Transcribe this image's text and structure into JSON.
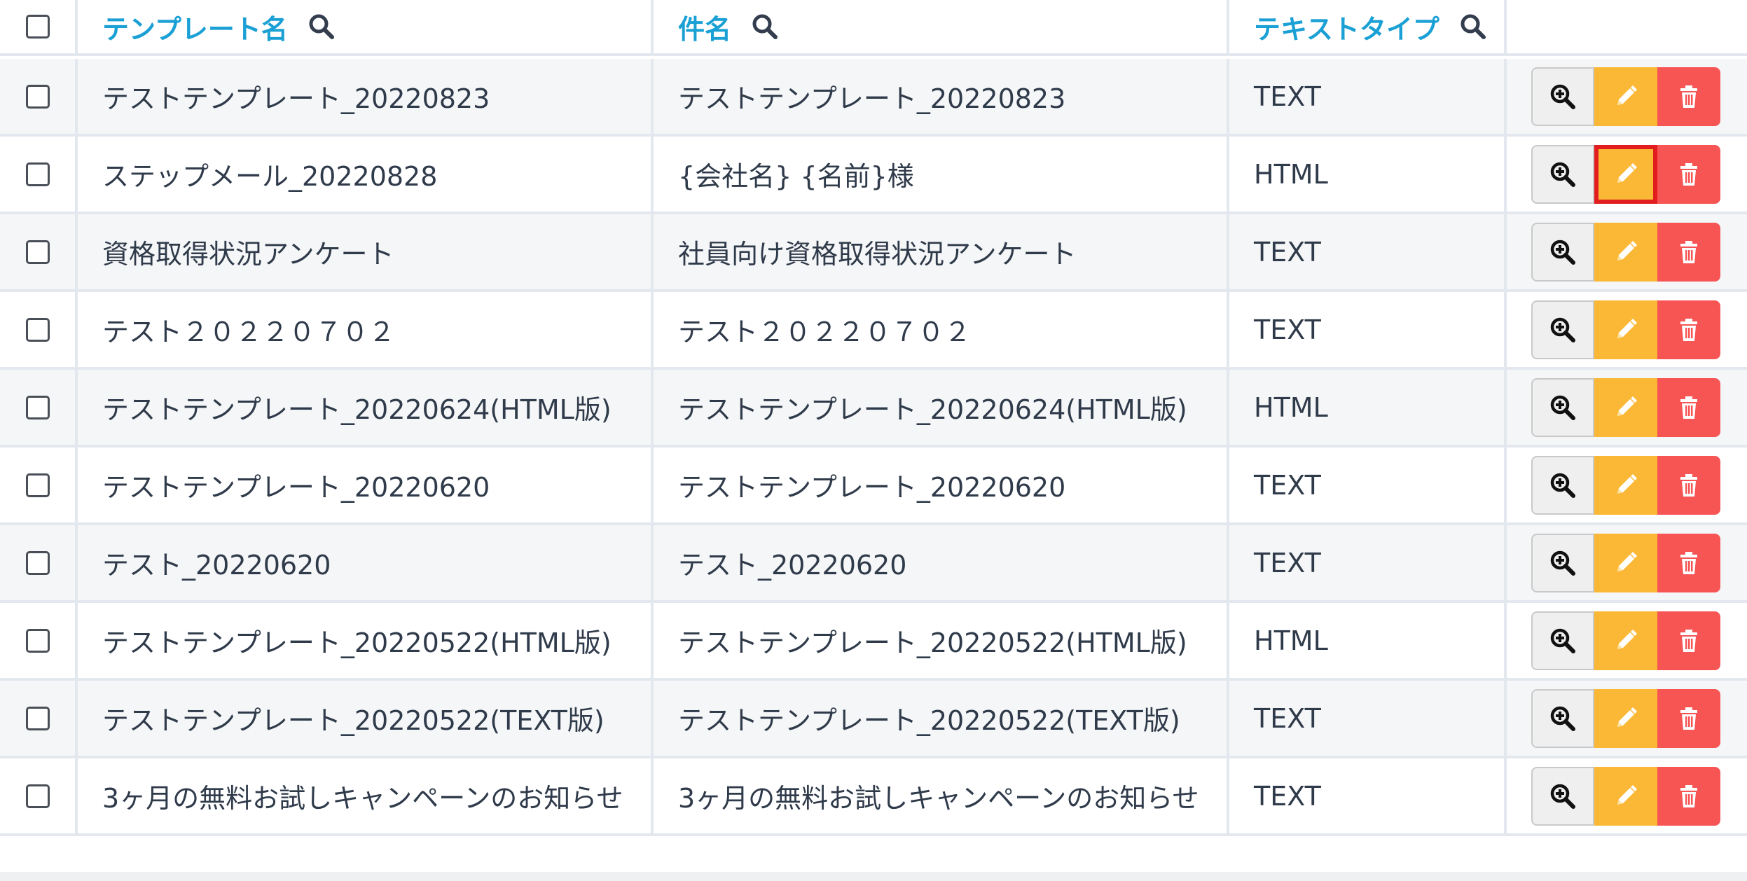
{
  "header": {
    "columns": [
      {
        "label": "テンプレート名",
        "has_search": true
      },
      {
        "label": "件名",
        "has_search": true
      },
      {
        "label": "テキストタイプ",
        "has_search": true
      },
      {
        "label": "",
        "has_search": false
      }
    ]
  },
  "rows": [
    {
      "name": "テストテンプレート_20220823",
      "subject": "テストテンプレート_20220823",
      "type": "TEXT",
      "edit_focused": false
    },
    {
      "name": "ステップメール_20220828",
      "subject": "{会社名} {名前}様",
      "type": "HTML",
      "edit_focused": true
    },
    {
      "name": "資格取得状況アンケート",
      "subject": "社員向け資格取得状況アンケート",
      "type": "TEXT",
      "edit_focused": false
    },
    {
      "name": "テスト２０２２０７０２",
      "subject": "テスト２０２２０７０２",
      "type": "TEXT",
      "edit_focused": false
    },
    {
      "name": "テストテンプレート_20220624(HTML版)",
      "subject": "テストテンプレート_20220624(HTML版)",
      "type": "HTML",
      "edit_focused": false
    },
    {
      "name": "テストテンプレート_20220620",
      "subject": "テストテンプレート_20220620",
      "type": "TEXT",
      "edit_focused": false
    },
    {
      "name": "テスト_20220620",
      "subject": "テスト_20220620",
      "type": "TEXT",
      "edit_focused": false
    },
    {
      "name": "テストテンプレート_20220522(HTML版)",
      "subject": "テストテンプレート_20220522(HTML版)",
      "type": "HTML",
      "edit_focused": false
    },
    {
      "name": "テストテンプレート_20220522(TEXT版)",
      "subject": "テストテンプレート_20220522(TEXT版)",
      "type": "TEXT",
      "edit_focused": false
    },
    {
      "name": "3ヶ月の無料お試しキャンペーンのお知らせ",
      "subject": "3ヶ月の無料お試しキャンペーンのお知らせ",
      "type": "TEXT",
      "edit_focused": false
    }
  ],
  "actions": {
    "view_icon": "zoom-in-icon",
    "edit_icon": "pencil-icon",
    "delete_icon": "trash-icon"
  },
  "colors": {
    "header_text": "#1aa0d4",
    "edit_button": "#fbb836",
    "delete_button": "#f75454",
    "focus_outline": "#e11d1d"
  }
}
